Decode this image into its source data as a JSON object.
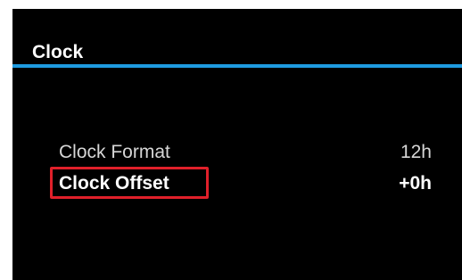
{
  "header": {
    "title": "Clock"
  },
  "menu": {
    "items": [
      {
        "label": "Clock Format",
        "value": "12h",
        "selected": false
      },
      {
        "label": "Clock Offset",
        "value": "+0h",
        "selected": true
      }
    ]
  },
  "colors": {
    "background": "#000000",
    "accent_line": "#1e9be0",
    "focus_border": "#e0202a",
    "text_primary": "#ffffff",
    "text_secondary": "#d6d6d6"
  }
}
